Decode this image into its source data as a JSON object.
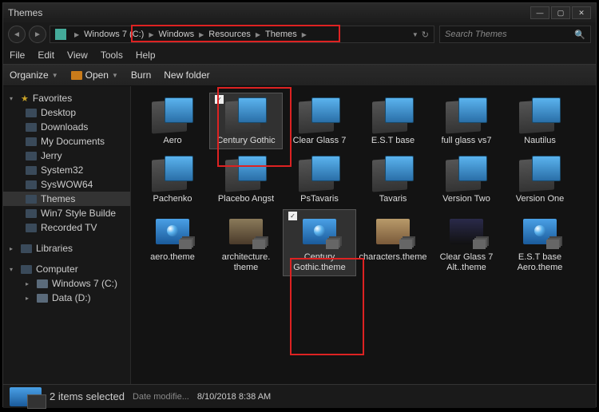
{
  "title": "Themes",
  "breadcrumb": [
    "Windows 7 (C:)",
    "Windows",
    "Resources",
    "Themes"
  ],
  "search_placeholder": "Search Themes",
  "menubar": [
    "File",
    "Edit",
    "View",
    "Tools",
    "Help"
  ],
  "toolbar": {
    "organize": "Organize",
    "open": "Open",
    "burn": "Burn",
    "newfolder": "New folder"
  },
  "sidebar": {
    "favorites": "Favorites",
    "fav_items": [
      "Desktop",
      "Downloads",
      "My Documents",
      "Jerry",
      "System32",
      "SysWOW64",
      "Themes",
      "Win7 Style Builde"
    ],
    "recorded": "Recorded TV",
    "libraries": "Libraries",
    "computer": "Computer",
    "comp_items": [
      "Windows 7 (C:)",
      "Data (D:)"
    ]
  },
  "folders": [
    {
      "label": "Aero",
      "sel": false
    },
    {
      "label": "Century Gothic",
      "sel": true
    },
    {
      "label": "Clear Glass 7",
      "sel": false
    },
    {
      "label": "E.S.T  base",
      "sel": false
    },
    {
      "label": "full glass vs7",
      "sel": false
    },
    {
      "label": "Nautilus",
      "sel": false
    },
    {
      "label": "Pachenko",
      "sel": false
    },
    {
      "label": "Placebo Angst",
      "sel": false
    },
    {
      "label": "PsTavaris",
      "sel": false
    },
    {
      "label": "Tavaris",
      "sel": false
    },
    {
      "label": "Version Two",
      "sel": false
    },
    {
      "label": "Version One",
      "sel": false
    }
  ],
  "themes": [
    {
      "label": "aero.theme",
      "cls": "",
      "sel": false
    },
    {
      "label": "architecture.\ntheme",
      "cls": "arch",
      "sel": false
    },
    {
      "label": "Century Gothic.theme",
      "cls": "",
      "sel": true
    },
    {
      "label": "characters.theme",
      "cls": "char",
      "sel": false
    },
    {
      "label": "Clear Glass 7 Alt..theme",
      "cls": "alt",
      "sel": false
    },
    {
      "label": "E.S.T  base Aero.theme",
      "cls": "",
      "sel": false
    }
  ],
  "status": {
    "count": "2 items selected",
    "label": "Date modifie...",
    "value": "8/10/2018 8:38 AM"
  }
}
